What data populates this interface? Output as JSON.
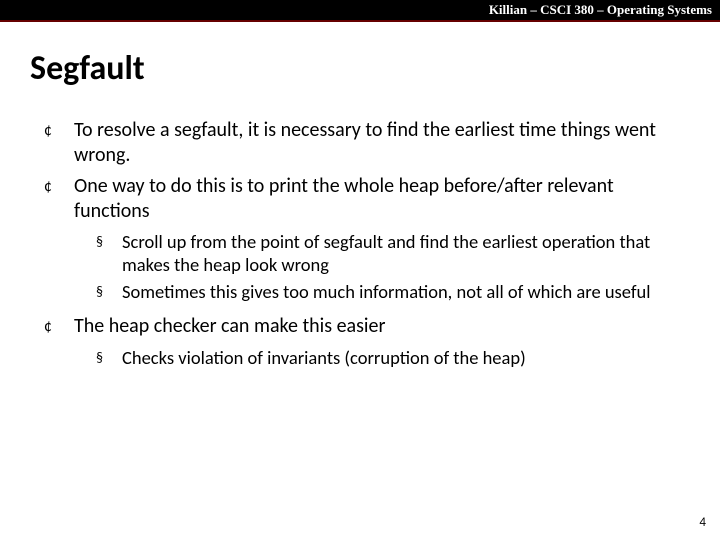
{
  "header": "Killian – CSCI 380 – Operating Systems",
  "title": "Segfault",
  "bullets": {
    "b1": "To resolve a segfault, it is necessary to find the earliest time things went wrong.",
    "b2": "One way to do this is to print the whole heap before/after relevant functions",
    "s1": "Scroll up from the point of segfault and find the earliest operation that makes the heap look wrong",
    "s2": "Sometimes this gives too much information, not all of which are useful",
    "b3": "The heap checker can make this easier",
    "s3": "Checks violation of invariants (corruption of the heap)"
  },
  "glyphs": {
    "circle": "¢",
    "square": "§"
  },
  "page": "4"
}
